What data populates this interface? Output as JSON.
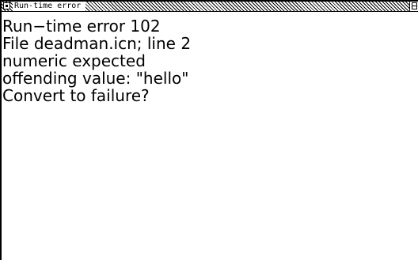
{
  "window": {
    "title": "Run-time error"
  },
  "message": {
    "lines": [
      "Run−time error 102",
      "File deadman.icn; line 2",
      "numeric expected",
      "offending value: \"hello\"",
      "Convert to failure?"
    ]
  },
  "icons": {
    "close": "close-box-icon",
    "zoom": "zoom-box-icon"
  },
  "colors": {
    "foreground": "#000000",
    "background": "#ffffff"
  }
}
